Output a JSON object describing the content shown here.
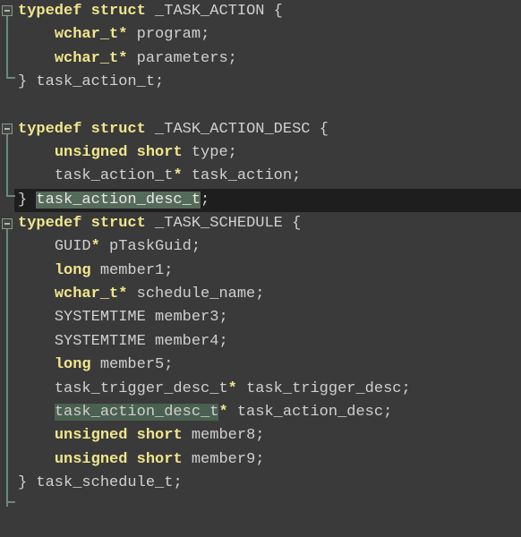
{
  "struct1": {
    "fold": "-",
    "typedef": "typedef",
    "struct": "struct",
    "name": "_TASK_ACTION",
    "brace_open": "{",
    "field1_type": "wchar_t",
    "field1_star": "*",
    "field1_name": "program",
    "field2_type": "wchar_t",
    "field2_star": "*",
    "field2_name": "parameters",
    "brace_close": "}",
    "alias": "task_action_t",
    "semi": ";"
  },
  "struct2": {
    "fold": "-",
    "typedef": "typedef",
    "struct": "struct",
    "name": "_TASK_ACTION_DESC",
    "brace_open": "{",
    "field1_type1": "unsigned",
    "field1_type2": "short",
    "field1_name": "type",
    "field2_type": "task_action_t",
    "field2_star": "*",
    "field2_name": "task_action",
    "brace_close": "}",
    "alias": "task_action_desc_t",
    "semi": ";"
  },
  "struct3": {
    "fold": "-",
    "typedef": "typedef",
    "struct": "struct",
    "name": "_TASK_SCHEDULE",
    "brace_open": "{",
    "f1_type": "GUID",
    "f1_star": "*",
    "f1_name": "pTaskGuid",
    "f2_type": "long",
    "f2_name": "member1",
    "f3_type": "wchar_t",
    "f3_star": "*",
    "f3_name": "schedule_name",
    "f4_type": "SYSTEMTIME",
    "f4_name": "member3",
    "f5_type": "SYSTEMTIME",
    "f5_name": "member4",
    "f6_type": "long",
    "f6_name": "member5",
    "f7_type": "task_trigger_desc_t",
    "f7_star": "*",
    "f7_name": "task_trigger_desc",
    "f8_type": "task_action_desc_t",
    "f8_star": "*",
    "f8_name": "task_action_desc",
    "f9_type1": "unsigned",
    "f9_type2": "short",
    "f9_name": "member8",
    "f10_type1": "unsigned",
    "f10_type2": "short",
    "f10_name": "member9",
    "brace_close": "}",
    "alias": "task_schedule_t",
    "semi": ";"
  }
}
